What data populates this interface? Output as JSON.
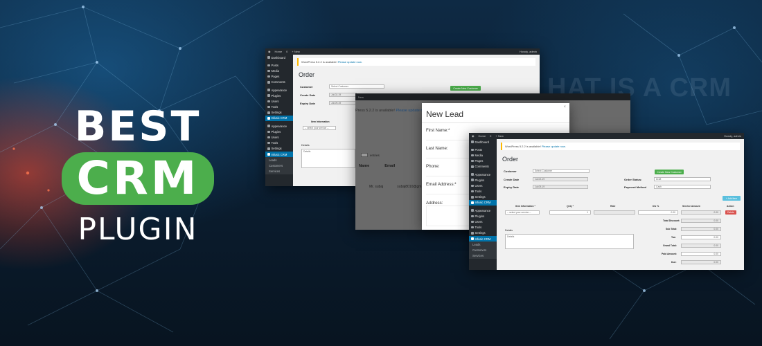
{
  "headline": {
    "line1": "BEST",
    "line2": "CRM",
    "line3": "PLUGIN"
  },
  "ghost_text": "HAT IS A CRM",
  "colors": {
    "green": "#4cae4c",
    "wp_dark": "#23282d",
    "wp_blue": "#0073aa",
    "red": "#d9534f"
  },
  "adminbar": {
    "site": "Home",
    "comments": "0",
    "new": "+ New",
    "howdy": "Howdy, admin"
  },
  "sidebar": {
    "items": [
      "Dashboard",
      "Posts",
      "Media",
      "Pages",
      "Comments",
      "Appearance",
      "Plugins",
      "Users",
      "Tools",
      "Settings",
      "Infusic CRM"
    ],
    "sub_items": [
      "Leads",
      "Customers",
      "Services"
    ]
  },
  "back_window": {
    "notice_pre": "WordPress 5.2.2 is available!",
    "notice_link": "Please update now.",
    "title": "Order",
    "customer_label": "Customer",
    "customer_value": "Select Customer",
    "create_btn": "Create New Customer",
    "create_date_label": "Create Date",
    "create_date_value": "Jul-02-19",
    "expiry_label": "Expiry Date",
    "expiry_value": "Jul-09-19",
    "item_header": "Item Information",
    "item_select": "-- select your service --",
    "details_label": "Details",
    "details_placeholder": "Details"
  },
  "mid_window": {
    "bar": "New",
    "notice_pre": "Press 5.2.2 is available!",
    "notice_link": "Please update now.",
    "entries": "entries",
    "col_name": "Name",
    "col_email": "Email",
    "row_name": "Mr. subaj",
    "row_email": "subaj8010@gm"
  },
  "modal": {
    "title": "New Lead",
    "close": "×",
    "fields": [
      "First Name:*",
      "Last Name:",
      "Phone:",
      "Email Address:*",
      "Address:"
    ]
  },
  "front_window": {
    "notice_pre": "WordPress 5.2.2 is available!",
    "notice_link": "Please update now.",
    "title": "Order",
    "customer_label": "Customer",
    "customer_value": "Select Customer",
    "create_btn": "Create New Customer",
    "create_date_label": "Create Date",
    "create_date_value": "Jul-02-19",
    "expiry_label": "Expiry Date",
    "expiry_value": "Jul-09-19",
    "order_status_label": "Order Status:",
    "order_status_value": "Draft",
    "payment_label": "Payment Method",
    "payment_value": "Cash",
    "add_item_btn": "+ Add Item",
    "cols": [
      "Item Information *",
      "Qnty *",
      "Rate",
      "Dis %",
      "Service Amount",
      "Action"
    ],
    "row_select": "-- select your service --",
    "row_qty": "1",
    "row_dis": "0.00",
    "row_amount": "0.00",
    "delete_btn": "Delete",
    "details_label": "Details",
    "details_placeholder": "Details",
    "totals": [
      {
        "label": "Total Discount:",
        "value": "0.00"
      },
      {
        "label": "Sub Total:",
        "value": "0.00"
      },
      {
        "label": "Tax:",
        "value": "0.00"
      },
      {
        "label": "Grand Total:",
        "value": "0.00"
      },
      {
        "label": "Paid Amount:",
        "value": "0.00"
      },
      {
        "label": "Due:",
        "value": "0.00"
      }
    ]
  }
}
